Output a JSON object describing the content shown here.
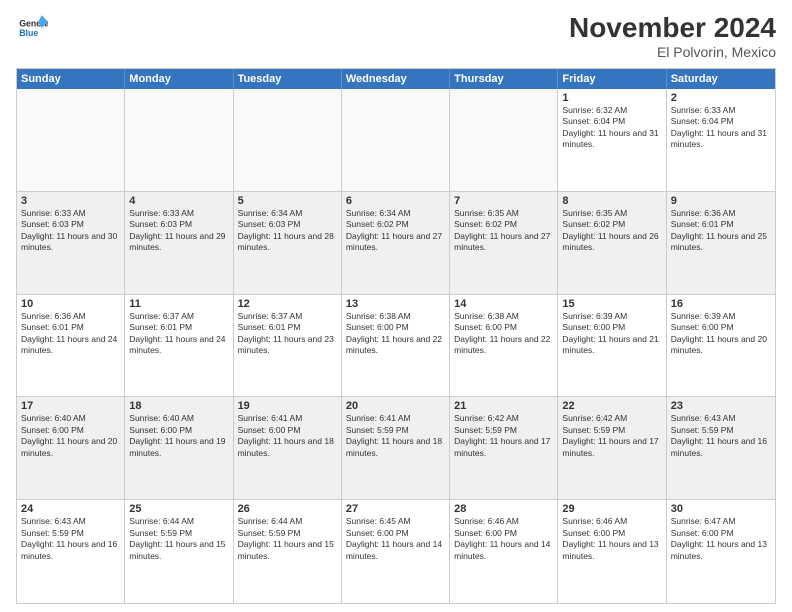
{
  "header": {
    "logo_line1": "General",
    "logo_line2": "Blue",
    "title": "November 2024",
    "subtitle": "El Polvorin, Mexico"
  },
  "weekdays": [
    "Sunday",
    "Monday",
    "Tuesday",
    "Wednesday",
    "Thursday",
    "Friday",
    "Saturday"
  ],
  "rows": [
    [
      {
        "day": "",
        "detail": ""
      },
      {
        "day": "",
        "detail": ""
      },
      {
        "day": "",
        "detail": ""
      },
      {
        "day": "",
        "detail": ""
      },
      {
        "day": "",
        "detail": ""
      },
      {
        "day": "1",
        "detail": "Sunrise: 6:32 AM\nSunset: 6:04 PM\nDaylight: 11 hours and 31 minutes."
      },
      {
        "day": "2",
        "detail": "Sunrise: 6:33 AM\nSunset: 6:04 PM\nDaylight: 11 hours and 31 minutes."
      }
    ],
    [
      {
        "day": "3",
        "detail": "Sunrise: 6:33 AM\nSunset: 6:03 PM\nDaylight: 11 hours and 30 minutes."
      },
      {
        "day": "4",
        "detail": "Sunrise: 6:33 AM\nSunset: 6:03 PM\nDaylight: 11 hours and 29 minutes."
      },
      {
        "day": "5",
        "detail": "Sunrise: 6:34 AM\nSunset: 6:03 PM\nDaylight: 11 hours and 28 minutes."
      },
      {
        "day": "6",
        "detail": "Sunrise: 6:34 AM\nSunset: 6:02 PM\nDaylight: 11 hours and 27 minutes."
      },
      {
        "day": "7",
        "detail": "Sunrise: 6:35 AM\nSunset: 6:02 PM\nDaylight: 11 hours and 27 minutes."
      },
      {
        "day": "8",
        "detail": "Sunrise: 6:35 AM\nSunset: 6:02 PM\nDaylight: 11 hours and 26 minutes."
      },
      {
        "day": "9",
        "detail": "Sunrise: 6:36 AM\nSunset: 6:01 PM\nDaylight: 11 hours and 25 minutes."
      }
    ],
    [
      {
        "day": "10",
        "detail": "Sunrise: 6:36 AM\nSunset: 6:01 PM\nDaylight: 11 hours and 24 minutes."
      },
      {
        "day": "11",
        "detail": "Sunrise: 6:37 AM\nSunset: 6:01 PM\nDaylight: 11 hours and 24 minutes."
      },
      {
        "day": "12",
        "detail": "Sunrise: 6:37 AM\nSunset: 6:01 PM\nDaylight: 11 hours and 23 minutes."
      },
      {
        "day": "13",
        "detail": "Sunrise: 6:38 AM\nSunset: 6:00 PM\nDaylight: 11 hours and 22 minutes."
      },
      {
        "day": "14",
        "detail": "Sunrise: 6:38 AM\nSunset: 6:00 PM\nDaylight: 11 hours and 22 minutes."
      },
      {
        "day": "15",
        "detail": "Sunrise: 6:39 AM\nSunset: 6:00 PM\nDaylight: 11 hours and 21 minutes."
      },
      {
        "day": "16",
        "detail": "Sunrise: 6:39 AM\nSunset: 6:00 PM\nDaylight: 11 hours and 20 minutes."
      }
    ],
    [
      {
        "day": "17",
        "detail": "Sunrise: 6:40 AM\nSunset: 6:00 PM\nDaylight: 11 hours and 20 minutes."
      },
      {
        "day": "18",
        "detail": "Sunrise: 6:40 AM\nSunset: 6:00 PM\nDaylight: 11 hours and 19 minutes."
      },
      {
        "day": "19",
        "detail": "Sunrise: 6:41 AM\nSunset: 6:00 PM\nDaylight: 11 hours and 18 minutes."
      },
      {
        "day": "20",
        "detail": "Sunrise: 6:41 AM\nSunset: 5:59 PM\nDaylight: 11 hours and 18 minutes."
      },
      {
        "day": "21",
        "detail": "Sunrise: 6:42 AM\nSunset: 5:59 PM\nDaylight: 11 hours and 17 minutes."
      },
      {
        "day": "22",
        "detail": "Sunrise: 6:42 AM\nSunset: 5:59 PM\nDaylight: 11 hours and 17 minutes."
      },
      {
        "day": "23",
        "detail": "Sunrise: 6:43 AM\nSunset: 5:59 PM\nDaylight: 11 hours and 16 minutes."
      }
    ],
    [
      {
        "day": "24",
        "detail": "Sunrise: 6:43 AM\nSunset: 5:59 PM\nDaylight: 11 hours and 16 minutes."
      },
      {
        "day": "25",
        "detail": "Sunrise: 6:44 AM\nSunset: 5:59 PM\nDaylight: 11 hours and 15 minutes."
      },
      {
        "day": "26",
        "detail": "Sunrise: 6:44 AM\nSunset: 5:59 PM\nDaylight: 11 hours and 15 minutes."
      },
      {
        "day": "27",
        "detail": "Sunrise: 6:45 AM\nSunset: 6:00 PM\nDaylight: 11 hours and 14 minutes."
      },
      {
        "day": "28",
        "detail": "Sunrise: 6:46 AM\nSunset: 6:00 PM\nDaylight: 11 hours and 14 minutes."
      },
      {
        "day": "29",
        "detail": "Sunrise: 6:46 AM\nSunset: 6:00 PM\nDaylight: 11 hours and 13 minutes."
      },
      {
        "day": "30",
        "detail": "Sunrise: 6:47 AM\nSunset: 6:00 PM\nDaylight: 11 hours and 13 minutes."
      }
    ]
  ]
}
